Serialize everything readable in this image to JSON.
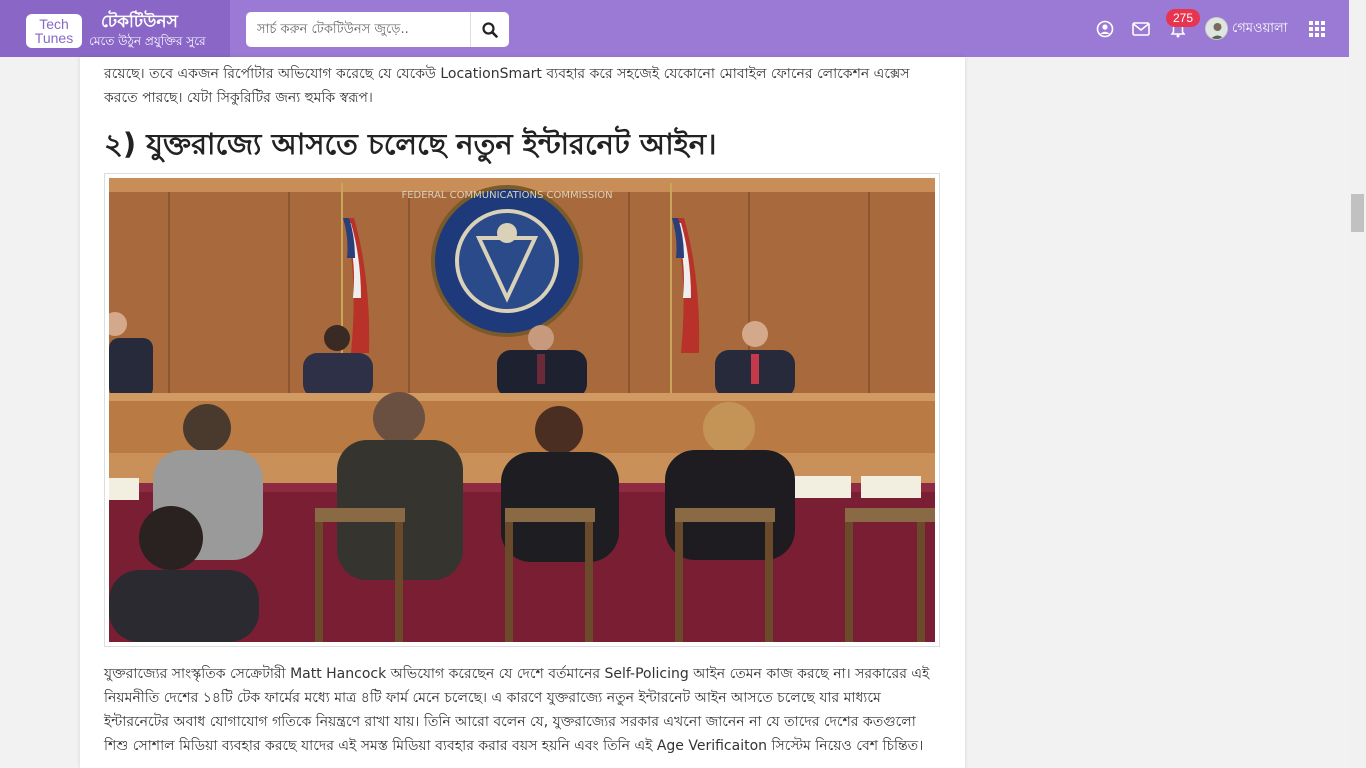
{
  "brand": {
    "logo_line1": "Tech",
    "logo_line2": "Tunes",
    "name": "টেকটিউনস",
    "tagline": "মেতে উঠুন প্রযুক্তির সুরে"
  },
  "search": {
    "placeholder": "সার্চ করুন টেকটিউনস জুড়ে..",
    "button_icon": "search-icon"
  },
  "nav": {
    "icons": [
      "user-circle-icon",
      "envelope-icon",
      "bell-icon",
      "grid-apps-icon"
    ],
    "notification_count": "275",
    "username": "গেমওয়ালা"
  },
  "article": {
    "intro_text": "রয়েছে। তবে একজন রির্পোটার অভিযোগ করেছে যে যেকেউ LocationSmart ব্যবহার করে সহজেই যেকোনো মোবাইল ফোনের লোকেশন এক্সেস করতে পারছে। যেটা সিকুরিটির জন্য হুমকি স্বরূপ।",
    "heading": "২) যুক্তরাজ্যে আসতে চলেছে নতুন ইন্টারনেট আইন।",
    "body_text": "যুক্তরাজ্যের সাংস্কৃতিক সেক্রেটারী Matt Hancock অভিযোগ করেছেন যে দেশে বর্তমানের Self-Policing আইন তেমন কাজ করছে না। সরকারের এই নিয়মনীতি দেশের ১৪টি টেক ফার্মের মধ্যে মাত্র ৪টি ফার্ম মেনে চলেছে। এ কারণে যুক্তরাজ্যে নতুন ইন্টারনেট আইন আসতে চলেছে যার মাধ্যমে ইন্টারনেটের অবাধ যোগাযোগ গতিকে নিয়ন্ত্রণে রাখা যায়। তিনি আরো বলেন যে, যুক্তরাজ্যের সরকার এখনো জানেন না যে তাদের দেশের কতগুলো শিশু সোশাল মিডিয়া ব্যবহার করছে যাদের এই সমস্ত মিডিয়া ব্যবহার করার বয়স হয়নি এবং তিনি এই Age Verificaiton সিস্টেম নিয়েও বেশ চিন্তিত।",
    "photo_seal_text": "FEDERAL COMMUNICATIONS COMMISSION"
  },
  "colors": {
    "topbar": "#9a7ad4",
    "brand_block": "#8a67c7",
    "badge": "#e8344e"
  }
}
